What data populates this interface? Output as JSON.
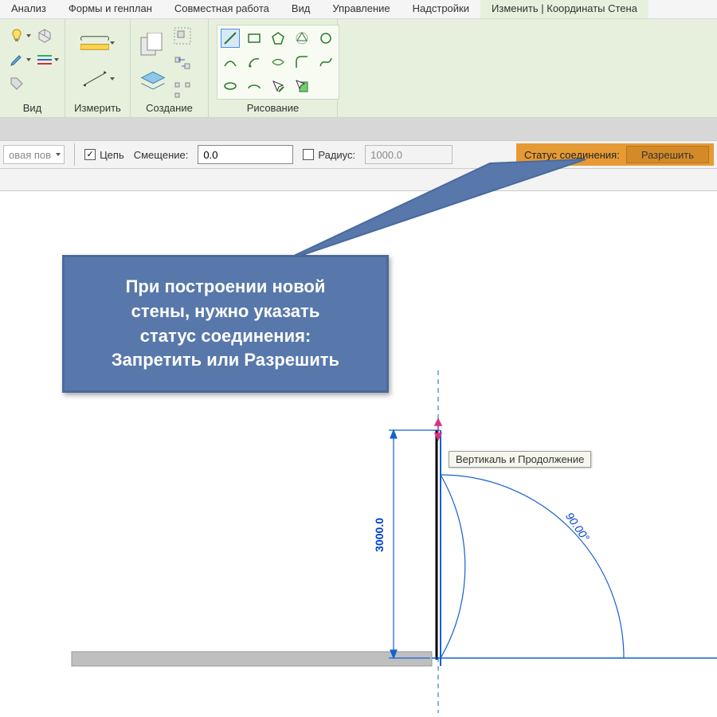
{
  "menu": {
    "items": [
      "Анализ",
      "Формы и генплан",
      "Совместная работа",
      "Вид",
      "Управление",
      "Надстройки",
      "Изменить | Координаты Стена"
    ],
    "active_index": 6
  },
  "ribbon": {
    "panels": {
      "view": "Вид",
      "measure": "Измерить",
      "create": "Создание",
      "draw": "Рисование"
    }
  },
  "options": {
    "dropdown_placeholder": "овая пов",
    "chain_label": "Цепь",
    "chain_checked": true,
    "offset_label": "Смещение:",
    "offset_value": "0.0",
    "radius_label": "Радиус:",
    "radius_checked": false,
    "radius_value": "1000.0",
    "status_label": "Статус соединения:",
    "status_value": "Разрешить"
  },
  "callout": {
    "text_line1": "При построении новой",
    "text_line2": "стены, нужно указать",
    "text_line3": "статус соединения:",
    "text_line4": "Запретить или Разрешить"
  },
  "tooltip": {
    "text": "Вертикаль и Продолжение"
  },
  "drawing": {
    "length_label": "3000.0",
    "angle_label": "90.00°"
  }
}
